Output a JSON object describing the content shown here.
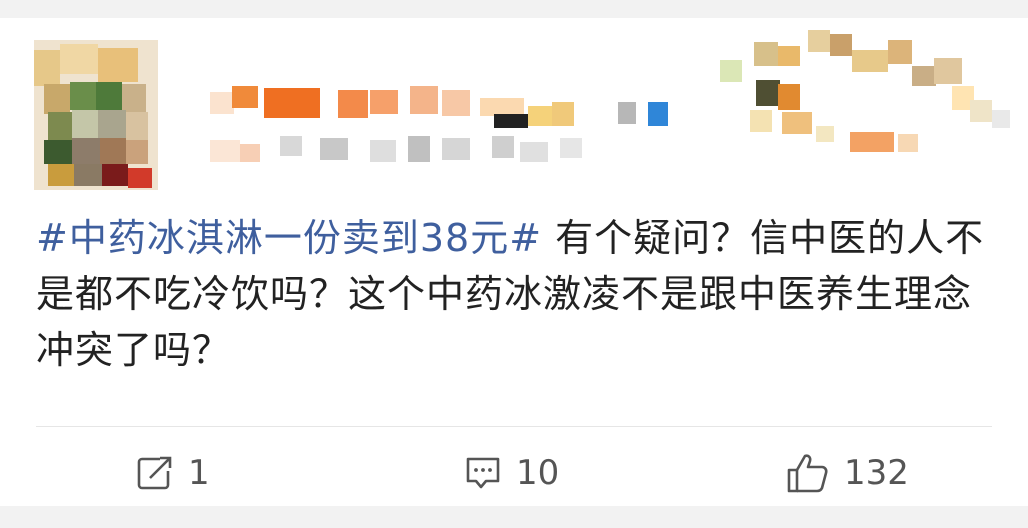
{
  "post": {
    "topic": "#中药冰淇淋一份卖到38元#",
    "body": " 有个疑问？信中医的人不是都不吃冷饮吗？这个中药冰激凌不是跟中医养生理念冲突了吗？"
  },
  "actions": {
    "repost_count": "1",
    "comment_count": "10",
    "like_count": "132"
  },
  "icons": {
    "repost": "repost-icon",
    "comment": "comment-icon",
    "like": "thumbs-up-icon"
  },
  "colors": {
    "topic_link": "#3f5f9e",
    "text": "#222222",
    "action_text": "#555555"
  }
}
